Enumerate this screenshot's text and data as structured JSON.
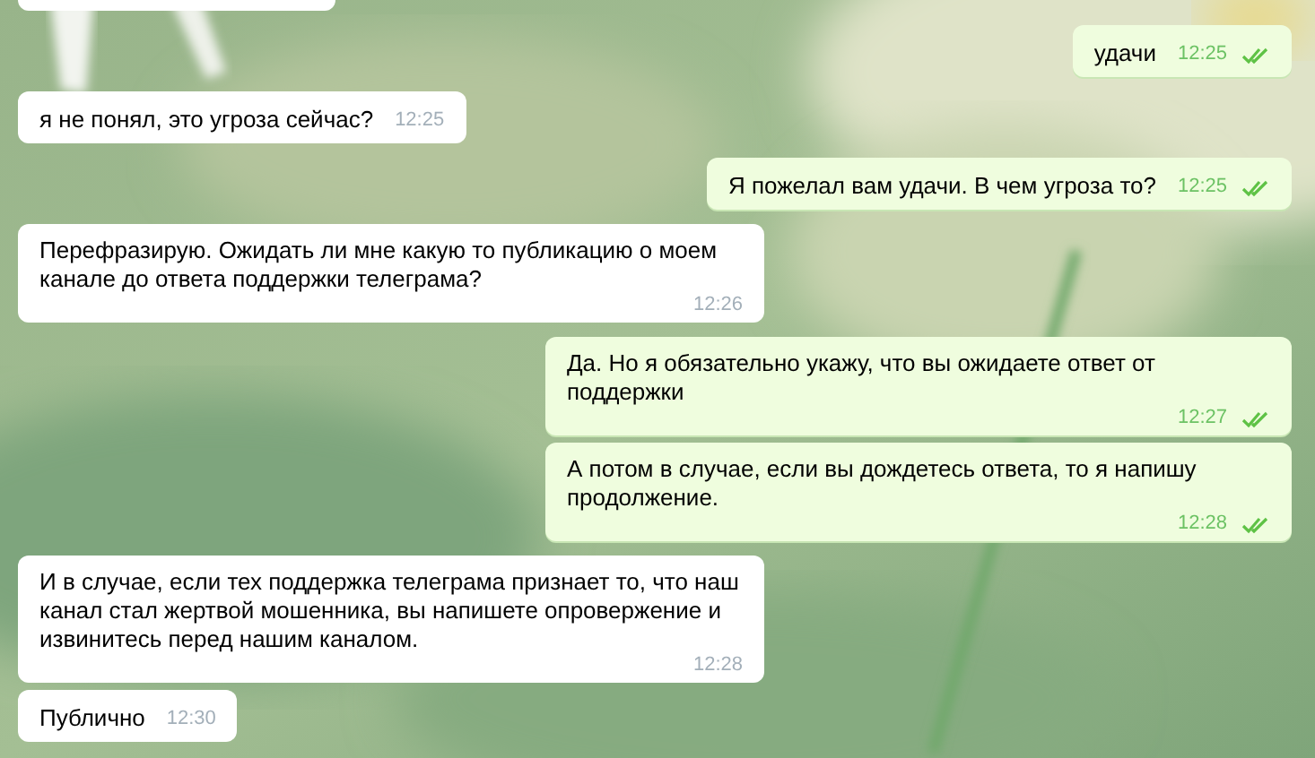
{
  "messages": [
    {
      "kind": "outgoing",
      "text": "удачи",
      "time": "12:25",
      "read": true
    },
    {
      "kind": "incoming",
      "text": "я не понял, это угроза сейчас?",
      "time": "12:25"
    },
    {
      "kind": "outgoing",
      "text": "Я пожелал вам удачи. В чем угроза то?",
      "time": "12:25",
      "read": true
    },
    {
      "kind": "incoming",
      "text": "Перефразирую. Ожидать ли мне какую то публикацию о моем канале до ответа поддержки телеграма?",
      "time": "12:26"
    },
    {
      "kind": "outgoing",
      "text": "Да. Но я обязательно укажу, что вы ожидаете ответ от поддержки",
      "time": "12:27",
      "read": true
    },
    {
      "kind": "outgoing",
      "text": "А потом в случае, если вы дождетесь ответа, то я напишу продолжение.",
      "time": "12:28",
      "read": true
    },
    {
      "kind": "incoming",
      "text": "И в случае, если тех поддержка телеграма признает то, что наш канал стал жертвой мошенника, вы напишете опровержение и извинитесь перед нашим каналом.",
      "time": "12:28"
    },
    {
      "kind": "incoming",
      "text": "Публично",
      "time": "12:30"
    }
  ]
}
